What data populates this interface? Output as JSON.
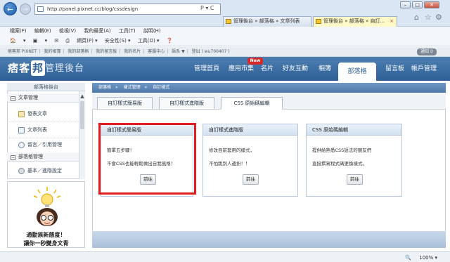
{
  "browser": {
    "url": "http://panel.pixnet.cc/blog/cssdesign",
    "addr_controls": "P ▾ C",
    "tabs": [
      {
        "label": "管理後台 » 部落格 » 文章列表"
      },
      {
        "label": "管理後台 » 部落格 » 自訂...",
        "close": "×"
      }
    ],
    "menu": [
      "檔案(F)",
      "編輯(E)",
      "檢視(V)",
      "我的最愛(A)",
      "工具(T)",
      "說明(H)"
    ],
    "toolbar": [
      "▾",
      "▾",
      "網頁(P) ▾",
      "安全性(S) ▾",
      "工具(O) ▾"
    ],
    "zoom": "100%"
  },
  "site": {
    "topbar": [
      "痞客邦 PIXNET",
      "我的相簿",
      "我的部落格",
      "我的留言板",
      "我的名片",
      "客服中心",
      "語系 ▼",
      "登出 ( wu700407 )"
    ],
    "notif": "通知 0",
    "logo": "痞客",
    "logo_mark": "邦",
    "logo_sub": "管理後台",
    "nav": [
      "管理首頁",
      "應用市集",
      "名片",
      "好友互動",
      "相簿",
      "部落格",
      "留言板",
      "帳戶管理"
    ],
    "new_badge": "New"
  },
  "sidebar": {
    "title": "部落格後台",
    "sections": [
      {
        "label": "文章管理",
        "items": [
          "發表文章",
          "文章列表",
          "留言／引用管理"
        ]
      },
      {
        "label": "部落格管理",
        "items": [
          "基本／進階設定"
        ]
      }
    ],
    "ad": {
      "line1": "通勤族新態度！",
      "line2": "讓你一秒變身文青"
    }
  },
  "main": {
    "breadcrumb": [
      "部落格",
      "樣式管理",
      "自訂樣式"
    ],
    "tabs": [
      "自訂樣式簡易版",
      "自訂樣式進階版",
      "CSS 原始碼編輯"
    ],
    "cards": [
      {
        "title": "自訂樣式簡易版",
        "lines": [
          "簡單五步驟！",
          "不會CSS也能輕鬆做出自我風格！"
        ],
        "button": "前往"
      },
      {
        "title": "自訂樣式進階版",
        "lines": [
          "修改目前套用的樣式，",
          "不怕跳別人邊扮！！"
        ],
        "button": "前往"
      },
      {
        "title": "CSS 原始碼編輯",
        "lines": [
          "提供給熟悉CSS語法的朋友們",
          "直接撰寫程式碼更換樣式。"
        ],
        "button": "前往"
      }
    ]
  }
}
